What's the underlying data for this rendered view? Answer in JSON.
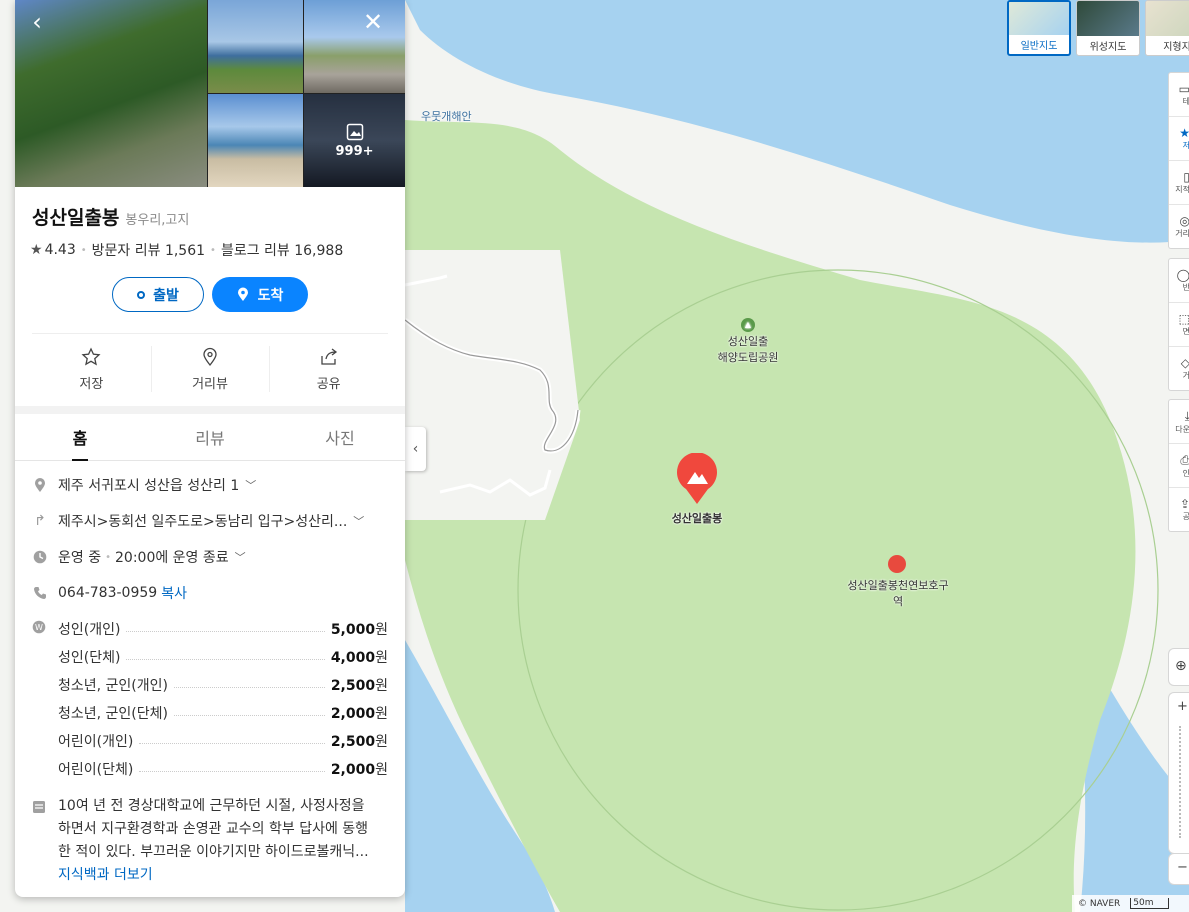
{
  "place": {
    "name": "성산일출봉",
    "category": "봉우리,고지",
    "rating": "4.43",
    "visitor_reviews": "방문자 리뷰 1,561",
    "blog_reviews": "블로그 리뷰 16,988",
    "photo_count": "999+"
  },
  "route": {
    "depart": "출발",
    "arrive": "도착"
  },
  "actions": [
    {
      "label": "저장",
      "icon": "star-icon"
    },
    {
      "label": "거리뷰",
      "icon": "pin-icon"
    },
    {
      "label": "공유",
      "icon": "share-icon"
    }
  ],
  "tabs": [
    "홈",
    "리뷰",
    "사진"
  ],
  "active_tab": "홈",
  "info": {
    "address": "제주 서귀포시 성산읍 성산리 1",
    "directions": "제주시>동회선 일주도로>동남리 입구>성산리...",
    "status": "운영 중",
    "hours": "20:00에 운영 종료",
    "phone": "064-783-0959",
    "copy": "복사"
  },
  "fees": [
    {
      "label": "성인(개인)",
      "price": "5,000",
      "unit": "원"
    },
    {
      "label": "성인(단체)",
      "price": "4,000",
      "unit": "원"
    },
    {
      "label": "청소년, 군인(개인)",
      "price": "2,500",
      "unit": "원"
    },
    {
      "label": "청소년, 군인(단체)",
      "price": "2,000",
      "unit": "원"
    },
    {
      "label": "어린이(개인)",
      "price": "2,500",
      "unit": "원"
    },
    {
      "label": "어린이(단체)",
      "price": "2,000",
      "unit": "원"
    }
  ],
  "description": {
    "text": "10여 년 전 경상대학교에 근무하던 시절, 사정사정을 하면서 지구환경학과 손영관 교수의 학부 답사에 동행한 적이 있다. 부끄러운 이야기지만 하이드로볼캐닉...",
    "more": "지식백과 더보기"
  },
  "map": {
    "map_types": [
      "일반지도",
      "위성지도",
      "지형지"
    ],
    "labels": {
      "bay": "우뭇개해안",
      "park_1": "성산일출",
      "park_2": "해양도립공원",
      "marker": "성산일출봉",
      "monument_1": "성산일출봉천연보호구",
      "monument_2": "역"
    },
    "tools": [
      "테",
      "저",
      "지적",
      "거리",
      "반",
      "면",
      "거",
      "다운",
      "인",
      "공"
    ],
    "copyright": "© NAVER",
    "scale": "50m",
    "colors": {
      "water": "#a6d2f0",
      "land": "#c6e5b0",
      "sand": "#f4f5f2",
      "accent": "#0a84ff",
      "marker": "#f0483d"
    }
  }
}
